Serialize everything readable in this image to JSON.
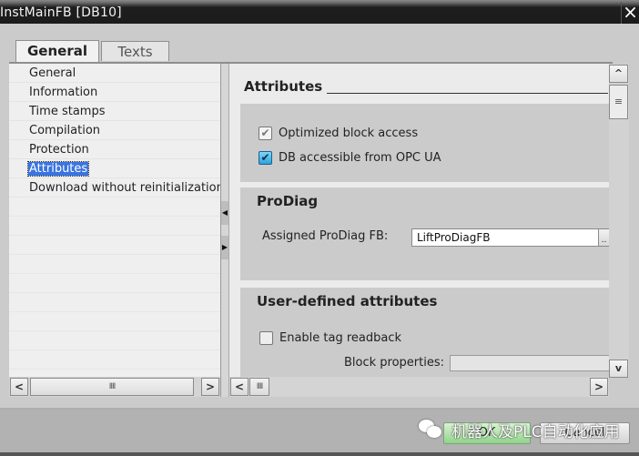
{
  "window": {
    "title": "InstMainFB [DB10]",
    "close_icon": "×"
  },
  "tabs": [
    {
      "label": "General",
      "active": true
    },
    {
      "label": "Texts",
      "active": false
    }
  ],
  "nav": {
    "items": [
      {
        "label": "General",
        "selected": false
      },
      {
        "label": "Information",
        "selected": false
      },
      {
        "label": "Time stamps",
        "selected": false
      },
      {
        "label": "Compilation",
        "selected": false
      },
      {
        "label": "Protection",
        "selected": false
      },
      {
        "label": "Attributes",
        "selected": true
      },
      {
        "label": "Download without reinitialization",
        "selected": false
      }
    ]
  },
  "scrollbars": {
    "left_arrow": "<",
    "right_arrow": ">",
    "up_arrow": "^",
    "down_arrow": "v",
    "thumb_grip": "IIII",
    "vthumb_grip": "≡",
    "splitter_left": "◀",
    "splitter_right": "▶"
  },
  "content": {
    "section_title": "Attributes",
    "attributes": {
      "optimized_block_access": {
        "label": "Optimized block access",
        "checked": true,
        "enabled": false
      },
      "db_accessible_opc_ua": {
        "label": "DB accessible from OPC UA",
        "checked": true,
        "enabled": true
      }
    },
    "prodiag": {
      "title": "ProDiag",
      "assigned_label": "Assigned ProDiag FB:",
      "assigned_value": "LiftProDiagFB",
      "browse_label": ".."
    },
    "user_defined": {
      "title": "User-defined attributes",
      "enable_tag_readback": {
        "label": "Enable tag readback",
        "checked": false
      },
      "block_properties_label": "Block properties:",
      "block_properties_value": ""
    }
  },
  "footer": {
    "ok_label": "OK",
    "cancel_label": "Cancel",
    "watermark": "机器人及PLC自动化应用"
  }
}
